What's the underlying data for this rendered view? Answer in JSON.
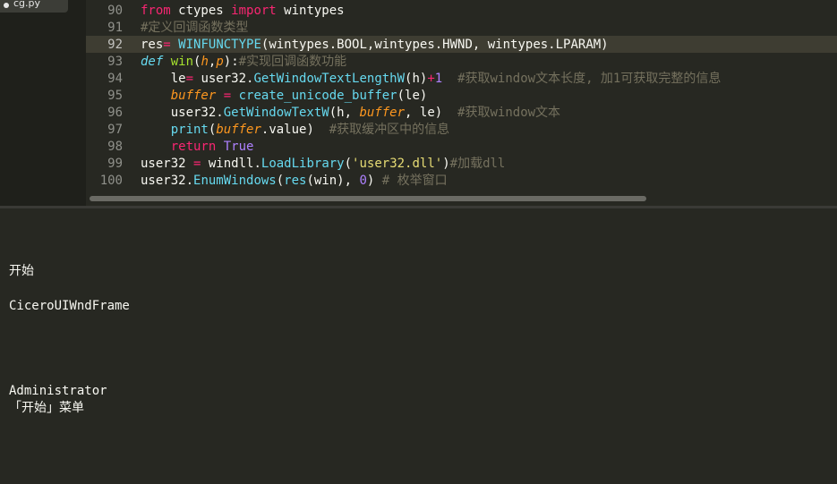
{
  "tab": {
    "filename": "cg.py"
  },
  "lines": [
    {
      "num": "90",
      "segments": [
        {
          "t": "from",
          "c": "kw"
        },
        {
          "t": " ctypes ",
          "c": ""
        },
        {
          "t": "import",
          "c": "kw"
        },
        {
          "t": " wintypes",
          "c": ""
        }
      ]
    },
    {
      "num": "91",
      "segments": [
        {
          "t": "#定义回调函数类型",
          "c": "cm"
        }
      ]
    },
    {
      "num": "92",
      "segments": [
        {
          "t": "res",
          "c": ""
        },
        {
          "t": "=",
          "c": "kw"
        },
        {
          "t": " ",
          "c": ""
        },
        {
          "t": "WINFUNCTYPE",
          "c": "fn"
        },
        {
          "t": "(wintypes.BOOL,wintypes.HWND, wintypes.LPARAM)",
          "c": ""
        }
      ]
    },
    {
      "num": "93",
      "segments": [
        {
          "t": "def",
          "c": "kwi"
        },
        {
          "t": " ",
          "c": ""
        },
        {
          "t": "win",
          "c": "tn"
        },
        {
          "t": "(",
          "c": ""
        },
        {
          "t": "h",
          "c": "prm"
        },
        {
          "t": ",",
          "c": ""
        },
        {
          "t": "p",
          "c": "prm"
        },
        {
          "t": "):",
          "c": ""
        },
        {
          "t": "#实现回调函数功能",
          "c": "cm"
        }
      ]
    },
    {
      "num": "94",
      "segments": [
        {
          "t": "    le",
          "c": ""
        },
        {
          "t": "=",
          "c": "kw"
        },
        {
          "t": " user32.",
          "c": ""
        },
        {
          "t": "GetWindowTextLengthW",
          "c": "fn"
        },
        {
          "t": "(h)",
          "c": ""
        },
        {
          "t": "+",
          "c": "kw"
        },
        {
          "t": "1",
          "c": "nm"
        },
        {
          "t": "  ",
          "c": ""
        },
        {
          "t": "#获取window文本长度, 加1可获取完整的信息",
          "c": "cm"
        }
      ]
    },
    {
      "num": "95",
      "segments": [
        {
          "t": "    ",
          "c": ""
        },
        {
          "t": "buffer",
          "c": "prm"
        },
        {
          "t": " ",
          "c": ""
        },
        {
          "t": "=",
          "c": "kw"
        },
        {
          "t": " ",
          "c": ""
        },
        {
          "t": "create_unicode_buffer",
          "c": "fn"
        },
        {
          "t": "(le)",
          "c": ""
        }
      ]
    },
    {
      "num": "96",
      "segments": [
        {
          "t": "    user32.",
          "c": ""
        },
        {
          "t": "GetWindowTextW",
          "c": "fn"
        },
        {
          "t": "(h, ",
          "c": ""
        },
        {
          "t": "buffer",
          "c": "prm"
        },
        {
          "t": ", le)  ",
          "c": ""
        },
        {
          "t": "#获取window文本",
          "c": "cm"
        }
      ]
    },
    {
      "num": "97",
      "segments": [
        {
          "t": "    ",
          "c": ""
        },
        {
          "t": "print",
          "c": "fn"
        },
        {
          "t": "(",
          "c": ""
        },
        {
          "t": "buffer",
          "c": "prm"
        },
        {
          "t": ".value)  ",
          "c": ""
        },
        {
          "t": "#获取缓冲区中的信息",
          "c": "cm"
        }
      ]
    },
    {
      "num": "98",
      "segments": [
        {
          "t": "    ",
          "c": ""
        },
        {
          "t": "return",
          "c": "kw"
        },
        {
          "t": " ",
          "c": ""
        },
        {
          "t": "True",
          "c": "nm"
        }
      ]
    },
    {
      "num": "99",
      "segments": [
        {
          "t": "user32 ",
          "c": ""
        },
        {
          "t": "=",
          "c": "kw"
        },
        {
          "t": " windll.",
          "c": ""
        },
        {
          "t": "LoadLibrary",
          "c": "fn"
        },
        {
          "t": "(",
          "c": ""
        },
        {
          "t": "'user32.dll'",
          "c": "st"
        },
        {
          "t": ")",
          "c": ""
        },
        {
          "t": "#加载dll",
          "c": "cm"
        }
      ]
    },
    {
      "num": "100",
      "segments": [
        {
          "t": "user32.",
          "c": ""
        },
        {
          "t": "EnumWindows",
          "c": "fn"
        },
        {
          "t": "(",
          "c": ""
        },
        {
          "t": "res",
          "c": "fn"
        },
        {
          "t": "(win), ",
          "c": ""
        },
        {
          "t": "0",
          "c": "nm"
        },
        {
          "t": ") ",
          "c": ""
        },
        {
          "t": "# 枚举窗口",
          "c": "cm"
        }
      ]
    }
  ],
  "active_line": "92",
  "output_lines": [
    "开始",
    "CiceroUIWndFrame",
    "Administrator",
    "「开始」菜单"
  ],
  "colors": {
    "background": "#272822",
    "keyword": "#f92672",
    "comment": "#75715e",
    "function": "#66d9ef",
    "parameter": "#fd971f",
    "number": "#ae81ff",
    "string": "#e6db74",
    "defname": "#a6e22e",
    "text": "#f8f8f2"
  },
  "icons": {
    "tab_dirty": "dot-icon"
  }
}
